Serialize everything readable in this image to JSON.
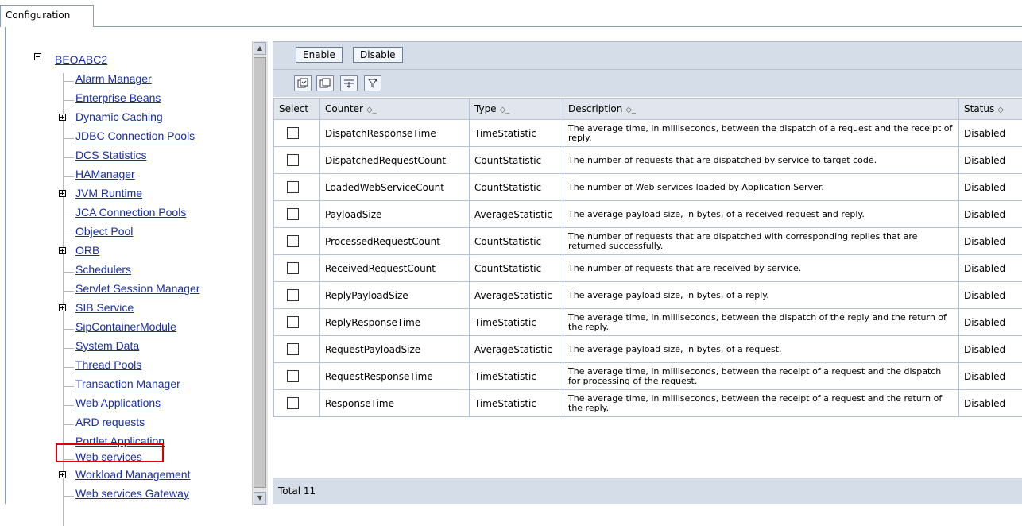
{
  "tab": {
    "label": "Configuration"
  },
  "tree": {
    "root": "BEOABC2",
    "items": [
      {
        "label": "Alarm Manager",
        "expandable": false
      },
      {
        "label": "Enterprise Beans",
        "expandable": false
      },
      {
        "label": "Dynamic Caching",
        "expandable": true
      },
      {
        "label": "JDBC Connection Pools",
        "expandable": false
      },
      {
        "label": "DCS Statistics",
        "expandable": false
      },
      {
        "label": "HAManager",
        "expandable": false
      },
      {
        "label": "JVM Runtime",
        "expandable": true
      },
      {
        "label": "JCA Connection Pools",
        "expandable": false
      },
      {
        "label": "Object Pool",
        "expandable": false
      },
      {
        "label": "ORB",
        "expandable": true
      },
      {
        "label": "Schedulers",
        "expandable": false
      },
      {
        "label": "Servlet Session Manager",
        "expandable": false
      },
      {
        "label": "SIB Service",
        "expandable": true
      },
      {
        "label": "SipContainerModule",
        "expandable": false
      },
      {
        "label": "System Data",
        "expandable": false
      },
      {
        "label": "Thread Pools",
        "expandable": false
      },
      {
        "label": "Transaction Manager",
        "expandable": false
      },
      {
        "label": "Web Applications",
        "expandable": false
      },
      {
        "label": "ARD requests",
        "expandable": false
      },
      {
        "label": "Portlet Application",
        "expandable": false
      },
      {
        "label": "Web services",
        "expandable": false
      },
      {
        "label": "Workload Management",
        "expandable": true
      },
      {
        "label": "Web services Gateway",
        "expandable": false
      }
    ]
  },
  "toolbar": {
    "enable": "Enable",
    "disable": "Disable"
  },
  "icons": [
    "select-all-icon",
    "deselect-all-icon",
    "show-filter-icon",
    "clear-filter-icon"
  ],
  "table": {
    "headers": {
      "select": "Select",
      "counter": "Counter",
      "type": "Type",
      "description": "Description",
      "status": "Status"
    },
    "sort_glyph": "◇_",
    "rows": [
      {
        "counter": "DispatchResponseTime",
        "type": "TimeStatistic",
        "description": "The average time, in milliseconds, between the dispatch of a request and the receipt of reply.",
        "status": "Disabled"
      },
      {
        "counter": "DispatchedRequestCount",
        "type": "CountStatistic",
        "description": "The number of requests that are dispatched by service to target code.",
        "status": "Disabled"
      },
      {
        "counter": "LoadedWebServiceCount",
        "type": "CountStatistic",
        "description": "The number of Web services loaded by Application Server.",
        "status": "Disabled"
      },
      {
        "counter": "PayloadSize",
        "type": "AverageStatistic",
        "description": "The average payload size, in bytes, of a received request and reply.",
        "status": "Disabled"
      },
      {
        "counter": "ProcessedRequestCount",
        "type": "CountStatistic",
        "description": "The number of requests that are dispatched with corresponding replies that are returned successfully.",
        "status": "Disabled"
      },
      {
        "counter": "ReceivedRequestCount",
        "type": "CountStatistic",
        "description": "The number of requests that are received by service.",
        "status": "Disabled"
      },
      {
        "counter": "ReplyPayloadSize",
        "type": "AverageStatistic",
        "description": "The average payload size, in bytes, of a reply.",
        "status": "Disabled"
      },
      {
        "counter": "ReplyResponseTime",
        "type": "TimeStatistic",
        "description": "The average time, in milliseconds, between the dispatch of the reply and the return of the reply.",
        "status": "Disabled"
      },
      {
        "counter": "RequestPayloadSize",
        "type": "AverageStatistic",
        "description": "The average payload size, in bytes, of a request.",
        "status": "Disabled"
      },
      {
        "counter": "RequestResponseTime",
        "type": "TimeStatistic",
        "description": "The average time, in milliseconds, between the receipt of a request and the dispatch for processing of the request.",
        "status": "Disabled"
      },
      {
        "counter": "ResponseTime",
        "type": "TimeStatistic",
        "description": "The average time, in milliseconds, between the receipt of a request and the return of the reply.",
        "status": "Disabled"
      }
    ]
  },
  "footer": {
    "total": "Total 11"
  }
}
